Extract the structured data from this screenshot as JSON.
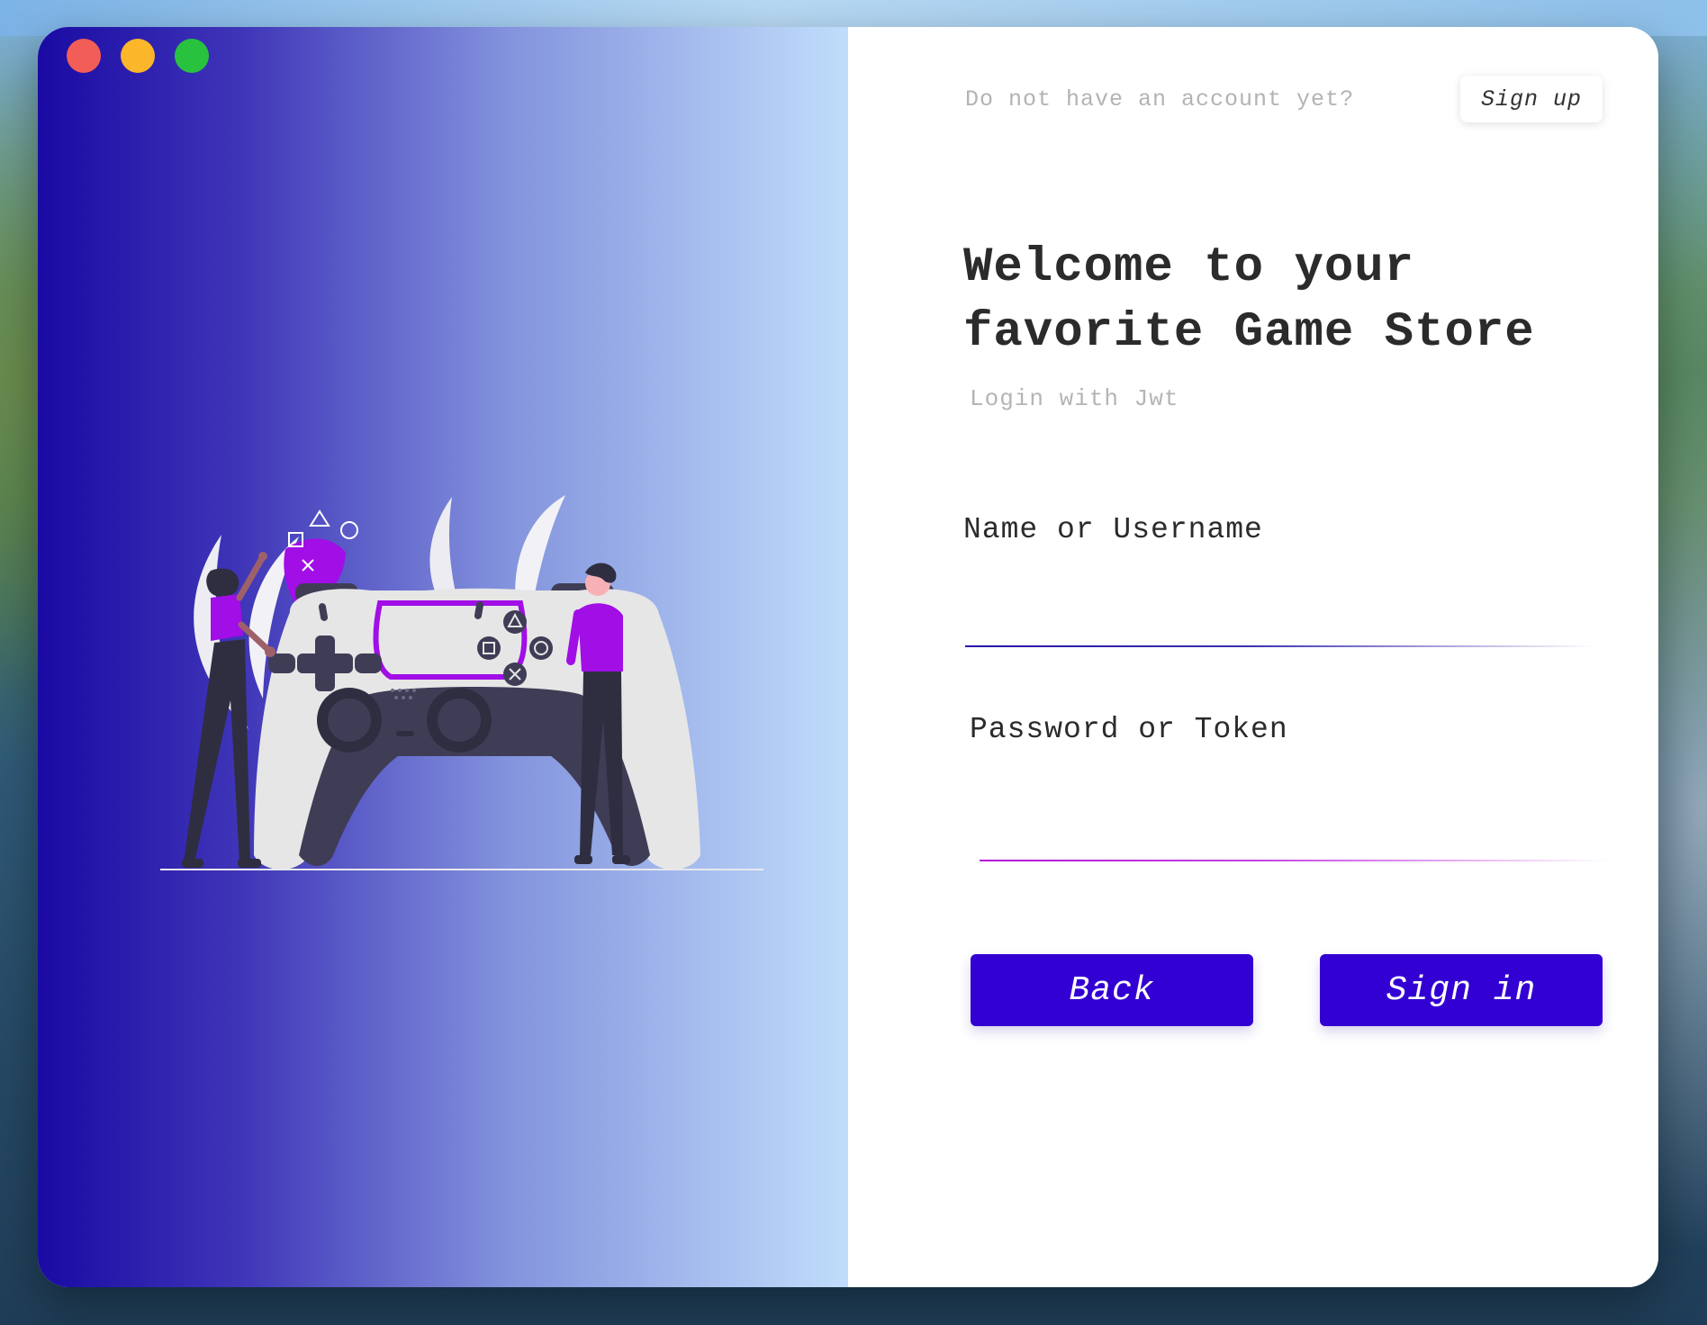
{
  "window": {
    "controls": [
      "close",
      "minimize",
      "maximize"
    ]
  },
  "illustration": {
    "subject": "game-controller-illustration"
  },
  "auth": {
    "prompt": "Do not have an account yet?",
    "signup_label": "Sign up",
    "title": "Welcome to your favorite Game Store",
    "subtitle": "Login with Jwt"
  },
  "form": {
    "name_label": "Name or Username",
    "name_value": "",
    "password_label": "Password or Token",
    "password_value": ""
  },
  "buttons": {
    "back_label": "Back",
    "signin_label": "Sign in"
  },
  "colors": {
    "accent": "#3300d3",
    "gradient_start": "#1a0aa3",
    "gradient_end": "#c0ddfb",
    "purple": "#a10ee6"
  }
}
